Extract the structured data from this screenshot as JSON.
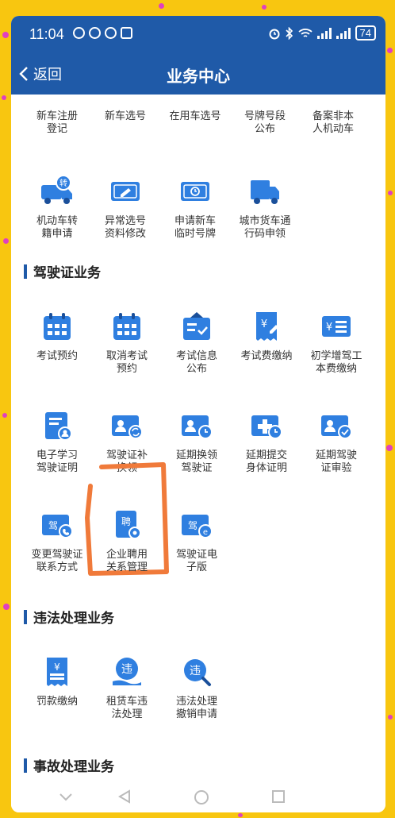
{
  "status_bar": {
    "time": "11:04",
    "battery": "74"
  },
  "nav": {
    "back_label": "返回",
    "title": "业务中心"
  },
  "vehicle_row1": [
    {
      "label": "新车注册\n登记"
    },
    {
      "label": "新车选号"
    },
    {
      "label": "在用车选号"
    },
    {
      "label": "号牌号段\n公布"
    },
    {
      "label": "备案非本\n人机动车"
    }
  ],
  "vehicle_row2": [
    {
      "label": "机动车转\n籍申请",
      "icon": "truck-transfer-icon"
    },
    {
      "label": "异常选号\n资料修改",
      "icon": "plate-edit-icon"
    },
    {
      "label": "申请新车\n临时号牌",
      "icon": "temp-plate-icon"
    },
    {
      "label": "城市货车通\n行码申领",
      "icon": "cargo-truck-icon"
    }
  ],
  "sections": {
    "license": "驾驶证业务",
    "violation": "违法处理业务",
    "accident": "事故处理业务"
  },
  "license_items": [
    {
      "label": "考试预约",
      "icon": "calendar-icon"
    },
    {
      "label": "取消考试\n预约",
      "icon": "calendar-cancel-icon"
    },
    {
      "label": "考试信息\n公布",
      "icon": "notice-board-icon"
    },
    {
      "label": "考试费缴纳",
      "icon": "fee-receipt-icon"
    },
    {
      "label": "初学增驾工\n本费缴纳",
      "icon": "fee-card-icon"
    },
    {
      "label": "电子学习\n驾驶证明",
      "icon": "document-user-icon"
    },
    {
      "label": "驾驶证补\n换领",
      "icon": "license-renew-icon"
    },
    {
      "label": "延期换领\n驾驶证",
      "icon": "license-clock-icon"
    },
    {
      "label": "延期提交\n身体证明",
      "icon": "health-clock-icon"
    },
    {
      "label": "延期驾驶\n证审验",
      "icon": "license-check-icon"
    },
    {
      "label": "变更驾驶证\n联系方式",
      "icon": "license-phone-icon"
    },
    {
      "label": "企业聘用\n关系管理",
      "icon": "employ-doc-icon"
    },
    {
      "label": "驾驶证电\n子版",
      "icon": "license-digital-icon"
    }
  ],
  "violation_items": [
    {
      "label": "罚款缴纳",
      "icon": "fine-receipt-icon"
    },
    {
      "label": "租赁车违\n法处理",
      "icon": "rental-violation-icon"
    },
    {
      "label": "违法处理\n撤销申请",
      "icon": "violation-search-icon"
    }
  ],
  "colors": {
    "header": "#1f5aa8",
    "icon_blue": "#2f7fe0",
    "highlight": "#f07a3a",
    "frame": "#f8c610"
  }
}
